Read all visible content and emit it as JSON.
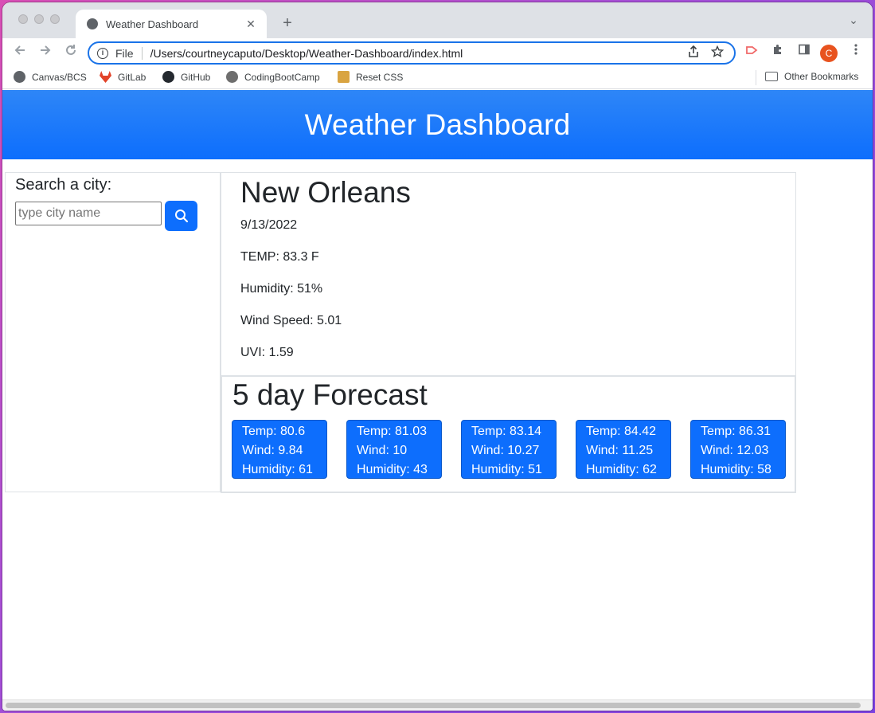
{
  "browser": {
    "tab_title": "Weather Dashboard",
    "tab_close": "✕",
    "new_tab": "+",
    "tab_menu": "⌄",
    "url_scheme": "File",
    "url": "/Users/courtneycaputo/Desktop/Weather-Dashboard/index.html",
    "avatar_letter": "C",
    "bookmarks": [
      {
        "label": "Canvas/BCS",
        "icon": "globe-icon",
        "color": "#5f6368"
      },
      {
        "label": "GitLab",
        "icon": "gitlab-icon",
        "color": "#e24329"
      },
      {
        "label": "GitHub",
        "icon": "github-icon",
        "color": "#24292f"
      },
      {
        "label": "CodingBootCamp",
        "icon": "codingbootcamp-icon",
        "color": "#6e6e6e"
      },
      {
        "label": "Reset CSS",
        "icon": "reset-css-icon",
        "color": "#d9a441"
      }
    ],
    "other_bookmarks": "Other Bookmarks"
  },
  "page": {
    "header_title": "Weather Dashboard",
    "search": {
      "label": "Search a city:",
      "placeholder": "type city name"
    },
    "current": {
      "city": "New Orleans",
      "date": "9/13/2022",
      "temp": "TEMP: 83.3 F",
      "humidity": "Humidity: 51%",
      "wind": "Wind Speed: 5.01",
      "uvi": "UVI: 1.59"
    },
    "forecast": {
      "title": "5 day Forecast",
      "days": [
        {
          "temp": "Temp: 80.6",
          "wind": "Wind: 9.84",
          "humidity": "Humidity: 61"
        },
        {
          "temp": "Temp: 81.03",
          "wind": "Wind: 10",
          "humidity": "Humidity: 43"
        },
        {
          "temp": "Temp: 83.14",
          "wind": "Wind: 10.27",
          "humidity": "Humidity: 51"
        },
        {
          "temp": "Temp: 84.42",
          "wind": "Wind: 11.25",
          "humidity": "Humidity: 62"
        },
        {
          "temp": "Temp: 86.31",
          "wind": "Wind: 12.03",
          "humidity": "Humidity: 58"
        }
      ]
    }
  },
  "colors": {
    "header_blue": "#0d6efd",
    "card_blue": "#0d6efd",
    "omnibox_focus": "#1a73e8"
  }
}
